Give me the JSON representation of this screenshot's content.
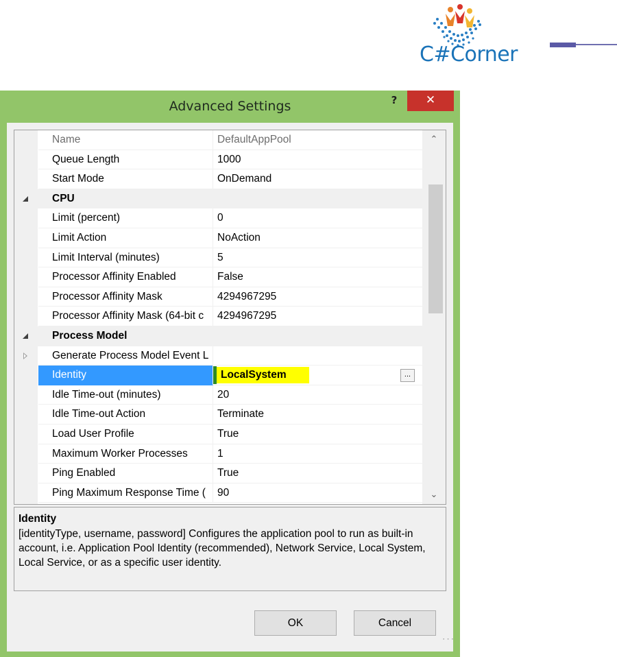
{
  "logo": {
    "text": "C#Corner"
  },
  "dialog": {
    "title": "Advanced Settings",
    "help_label": "?",
    "close_label": "✕"
  },
  "grid": {
    "rows": [
      {
        "type": "property",
        "name": "Name",
        "value": "DefaultAppPool",
        "dim": true
      },
      {
        "type": "property",
        "name": "Queue Length",
        "value": "1000"
      },
      {
        "type": "property",
        "name": "Start Mode",
        "value": "OnDemand"
      },
      {
        "type": "category",
        "name": "CPU"
      },
      {
        "type": "property",
        "name": "Limit (percent)",
        "value": "0"
      },
      {
        "type": "property",
        "name": "Limit Action",
        "value": "NoAction"
      },
      {
        "type": "property",
        "name": "Limit Interval (minutes)",
        "value": "5"
      },
      {
        "type": "property",
        "name": "Processor Affinity Enabled",
        "value": "False"
      },
      {
        "type": "property",
        "name": "Processor Affinity Mask",
        "value": "4294967295"
      },
      {
        "type": "property",
        "name": "Processor Affinity Mask (64-bit c",
        "value": "4294967295"
      },
      {
        "type": "category",
        "name": "Process Model"
      },
      {
        "type": "expandable",
        "name": "Generate Process Model Event L",
        "value": ""
      },
      {
        "type": "selected",
        "name": "Identity",
        "value": "LocalSystem",
        "button": "..."
      },
      {
        "type": "property",
        "name": "Idle Time-out (minutes)",
        "value": "20"
      },
      {
        "type": "property",
        "name": "Idle Time-out Action",
        "value": "Terminate"
      },
      {
        "type": "property",
        "name": "Load User Profile",
        "value": "True"
      },
      {
        "type": "property",
        "name": "Maximum Worker Processes",
        "value": "1"
      },
      {
        "type": "property",
        "name": "Ping Enabled",
        "value": "True"
      },
      {
        "type": "property",
        "name": "Ping Maximum Response Time (",
        "value": "90"
      }
    ],
    "scroll_up": "⌃",
    "scroll_down": "⌄"
  },
  "description": {
    "title": "Identity",
    "text": "[identityType, username, password] Configures the application pool to run as built-in account, i.e. Application Pool Identity (recommended), Network Service, Local System, Local Service, or as a specific user identity."
  },
  "buttons": {
    "ok": "OK",
    "cancel": "Cancel"
  },
  "colors": {
    "dialog_frame": "#92c569",
    "close_button": "#c7322b",
    "selection": "#3399ff",
    "highlight": "#ffff00"
  },
  "icons": {
    "help": "question-icon",
    "close": "close-icon",
    "collapse": "triangle-collapse-icon",
    "expand": "triangle-expand-icon"
  }
}
